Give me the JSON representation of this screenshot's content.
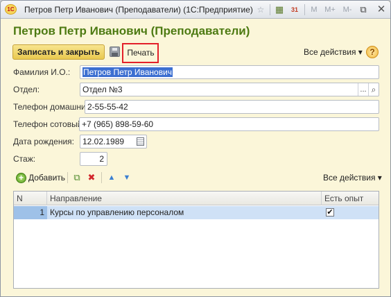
{
  "window": {
    "title": "Петров Петр Иванович (Преподаватели)  (1С:Предприятие)",
    "logo_text": "1С",
    "toolbar_glyphs": {
      "nav_mode": "⌂",
      "favorite": "☆",
      "calculator": "▦",
      "calendar": "31",
      "mem_m": "M",
      "mem_m_plus": "M+",
      "mem_m_minus": "M-",
      "restore": "⧉",
      "close": "✕"
    }
  },
  "form": {
    "title": "Петров Петр Иванович (Преподаватели)",
    "save_close_label": "Записать и закрыть",
    "print_label": "Печать",
    "all_actions_label": "Все действия ▾",
    "help_label": "?"
  },
  "fields": {
    "fio_label": "Фамилия И.О.:",
    "fio_value": "Петров Петр Иванович",
    "department_label": "Отдел:",
    "department_value": "Отдел №3",
    "department_dots": "...",
    "department_search": "⌕",
    "home_phone_label": "Телефон домашний:",
    "home_phone_value": "2-55-55-42",
    "mobile_phone_label": "Телефон сотовый:",
    "mobile_phone_value": "+7 (965) 898-59-60",
    "birth_date_label": "Дата рождения:",
    "birth_date_value": "12.02.1989",
    "experience_label": "Стаж:",
    "experience_value": "2"
  },
  "table_toolbar": {
    "add_label": "Добавить",
    "add_glyph": "+",
    "copy_glyph": "⧉",
    "delete_glyph": "✖",
    "up_glyph": "▲",
    "down_glyph": "▼",
    "all_actions_label": "Все действия ▾"
  },
  "table": {
    "columns": [
      "N",
      "Направление",
      "Есть опыт"
    ],
    "rows": [
      {
        "n": "1",
        "direction": "Курсы по управлению персоналом",
        "has_experience": "✔"
      }
    ]
  }
}
